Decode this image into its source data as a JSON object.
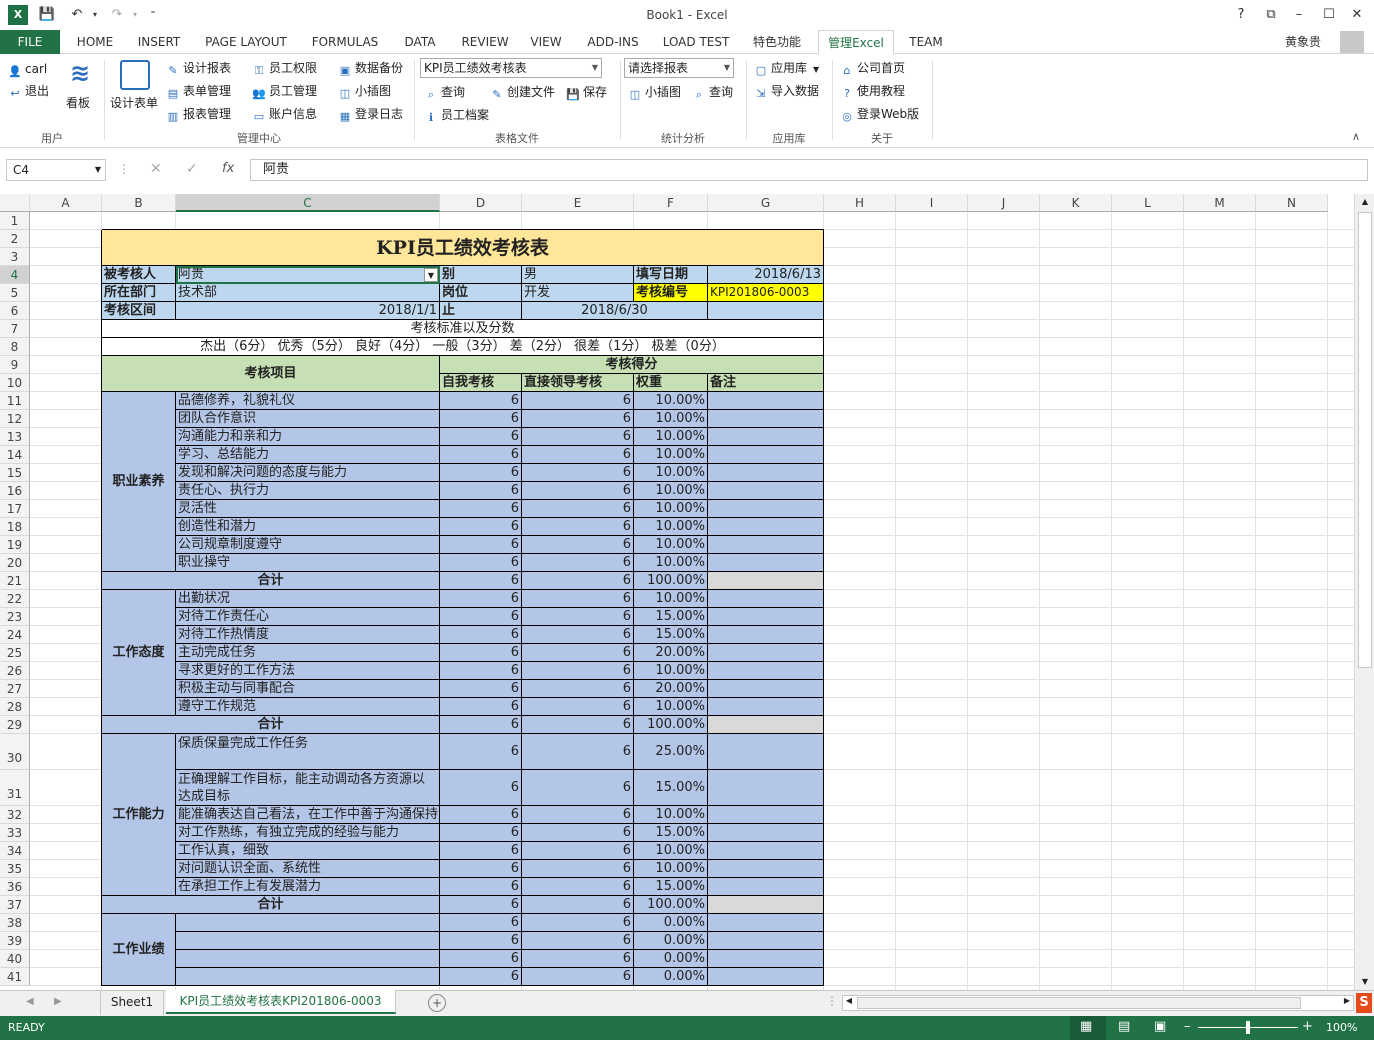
{
  "app": {
    "title": "Book1 - Excel",
    "user": "黄象贵"
  },
  "tabs": [
    "FILE",
    "HOME",
    "INSERT",
    "PAGE LAYOUT",
    "FORMULAS",
    "DATA",
    "REVIEW",
    "VIEW",
    "ADD-INS",
    "LOAD TEST",
    "特色功能",
    "管理Excel",
    "TEAM"
  ],
  "ribbon": {
    "user": {
      "carl": "carl",
      "logout": "退出",
      "board": "看板",
      "label": "用户"
    },
    "mgmt": {
      "design_form": "设计表单",
      "design_report": "设计报表",
      "form_mgr": "表单管理",
      "report_mgr": "报表管理",
      "emp_perm": "员工权限",
      "emp_mgr": "员工管理",
      "acct_info": "账户信息",
      "backup": "数据备份",
      "mini_chart": "小插图",
      "login_log": "登录日志",
      "label": "管理中心"
    },
    "table_file": {
      "combo": "KPI员工绩效考核表",
      "query": "查询",
      "create": "创建文件",
      "save": "保存",
      "emp_file": "员工档案",
      "label": "表格文件"
    },
    "stats": {
      "combo": "请选择报表",
      "mini_chart": "小插图",
      "query": "查询",
      "label": "统计分析"
    },
    "apps": {
      "app_store": "应用库",
      "import": "导入数据",
      "label": "应用库"
    },
    "about": {
      "home": "公司首页",
      "tutorial": "使用教程",
      "web": "登录Web版",
      "label": "关于"
    }
  },
  "formula": {
    "cell": "C4",
    "value": "阿贵"
  },
  "columns": [
    "A",
    "B",
    "C",
    "D",
    "E",
    "F",
    "G",
    "H",
    "I",
    "J",
    "K",
    "L",
    "M",
    "N"
  ],
  "rows": [
    "1",
    "2",
    "3",
    "4",
    "5",
    "6",
    "7",
    "8",
    "9",
    "10",
    "11",
    "12",
    "13",
    "14",
    "15",
    "16",
    "17",
    "18",
    "19",
    "20",
    "21",
    "22",
    "23",
    "24",
    "25",
    "26",
    "27",
    "28",
    "29",
    "30",
    "31",
    "32",
    "33",
    "34",
    "35",
    "36",
    "37",
    "38",
    "39",
    "40",
    "41"
  ],
  "sheet": {
    "title": "KPI员工绩效考核表",
    "h4": {
      "label": "被考核人",
      "name": "阿贵",
      "gender_label": "别",
      "gender": "男",
      "date_label": "填写日期",
      "date": "2018/6/13"
    },
    "h5": {
      "label": "所在部门",
      "dept": "技术部",
      "post_label": "岗位",
      "post": "开发",
      "code_label": "考核编号",
      "code": "KPI201806-0003"
    },
    "h6": {
      "label": "考核区间",
      "from": "2018/1/1",
      "to_label": "止",
      "to": "2018/6/30"
    },
    "std_title": "考核标准以及分数",
    "std": "杰出（6分） 优秀（5分） 良好（4分） 一般（3分） 差（2分） 很差（1分） 极差（0分）",
    "hdr": {
      "item": "考核项目",
      "score": "考核得分",
      "self": "自我考核",
      "leader": "直接领导考核",
      "weight": "权重",
      "note": "备注"
    },
    "total": "合计",
    "groups": [
      {
        "name": "职业素养",
        "items": [
          [
            "品德修养，礼貌礼仪",
            "6",
            "6",
            "10.00%"
          ],
          [
            "团队合作意识",
            "6",
            "6",
            "10.00%"
          ],
          [
            "沟通能力和亲和力",
            "6",
            "6",
            "10.00%"
          ],
          [
            "学习、总结能力",
            "6",
            "6",
            "10.00%"
          ],
          [
            "发现和解决问题的态度与能力",
            "6",
            "6",
            "10.00%"
          ],
          [
            "责任心、执行力",
            "6",
            "6",
            "10.00%"
          ],
          [
            "灵活性",
            "6",
            "6",
            "10.00%"
          ],
          [
            "创造性和潜力",
            "6",
            "6",
            "10.00%"
          ],
          [
            "公司规章制度遵守",
            "6",
            "6",
            "10.00%"
          ],
          [
            "职业操守",
            "6",
            "6",
            "10.00%"
          ]
        ],
        "sum": [
          "6",
          "6",
          "100.00%"
        ]
      },
      {
        "name": "工作态度",
        "items": [
          [
            "出勤状况",
            "6",
            "6",
            "10.00%"
          ],
          [
            "对待工作责任心",
            "6",
            "6",
            "15.00%"
          ],
          [
            "对待工作热情度",
            "6",
            "6",
            "15.00%"
          ],
          [
            "主动完成任务",
            "6",
            "6",
            "20.00%"
          ],
          [
            "寻求更好的工作方法",
            "6",
            "6",
            "10.00%"
          ],
          [
            "积极主动与同事配合",
            "6",
            "6",
            "20.00%"
          ],
          [
            "遵守工作规范",
            "6",
            "6",
            "10.00%"
          ]
        ],
        "sum": [
          "6",
          "6",
          "100.00%"
        ]
      },
      {
        "name": "工作能力",
        "items": [
          [
            "保质保量完成工作任务",
            "6",
            "6",
            "25.00%"
          ],
          [
            "正确理解工作目标，能主动调动各方资源以达成目标",
            "6",
            "6",
            "15.00%"
          ],
          [
            "能准确表达自己看法，在工作中善于沟通保持良好团结的人际关系",
            "6",
            "6",
            "10.00%"
          ],
          [
            "对工作熟练，有独立完成的经验与能力",
            "6",
            "6",
            "15.00%"
          ],
          [
            "工作认真，细致",
            "6",
            "6",
            "10.00%"
          ],
          [
            "对问题认识全面、系统性",
            "6",
            "6",
            "10.00%"
          ],
          [
            "在承担工作上有发展潜力",
            "6",
            "6",
            "15.00%"
          ]
        ],
        "sum": [
          "6",
          "6",
          "100.00%"
        ]
      },
      {
        "name": "工作业绩",
        "items": [
          [
            "",
            "6",
            "6",
            "0.00%"
          ],
          [
            "",
            "6",
            "6",
            "0.00%"
          ],
          [
            "",
            "6",
            "6",
            "0.00%"
          ],
          [
            "",
            "6",
            "6",
            "0.00%"
          ]
        ]
      }
    ]
  },
  "sheets": [
    "Sheet1",
    "KPI员工绩效考核表KPI201806-0003"
  ],
  "status": {
    "ready": "READY",
    "zoom": "100%"
  },
  "colors": {
    "excel_green": "#217346",
    "title_fill": "#ffe699",
    "label_fill": "#bdd7ee",
    "green_fill": "#c6e0b4",
    "blue_fill": "#b4c6e7",
    "yellow": "#ffff00",
    "gray": "#d9d9d9"
  }
}
